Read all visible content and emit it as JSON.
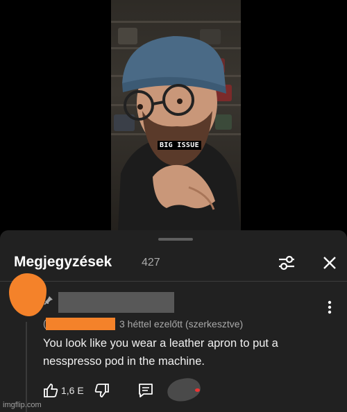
{
  "video": {
    "caption": "BIG ISSUE"
  },
  "comments": {
    "title": "Megjegyzések",
    "count": "427",
    "filter_icon": "sliders-icon",
    "close_icon": "close-icon"
  },
  "comment": {
    "handle_prefix": "(",
    "meta": "3 héttel ezelőtt (szerkesztve)",
    "text": "You look like you wear a leather apron to put a nesspresso pod in the machine.",
    "likes": "1,6 E",
    "pinned": true
  },
  "colors": {
    "sheet_bg": "#212121",
    "redaction_orange": "#f4822a",
    "redaction_gray": "#585858"
  },
  "watermark": "imgflip.com"
}
